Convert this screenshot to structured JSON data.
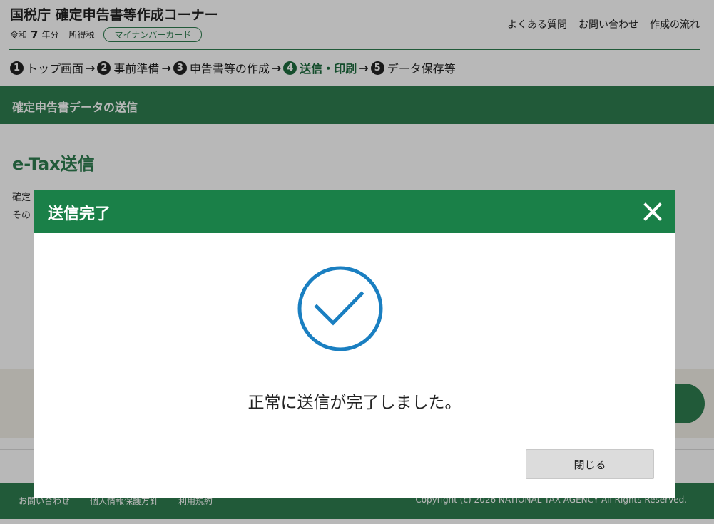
{
  "header": {
    "site_title": "国税庁 確定申告書等作成コーナー",
    "era": "令和",
    "year": "7",
    "year_suffix": "年分",
    "tax_type": "所得税",
    "badge": "マイナンバーカード",
    "links": [
      "よくある質問",
      "お問い合わせ",
      "作成の流れ"
    ]
  },
  "steps": [
    {
      "num": "1",
      "label": "トップ画面"
    },
    {
      "num": "2",
      "label": "事前準備"
    },
    {
      "num": "3",
      "label": "申告書等の作成"
    },
    {
      "num": "4",
      "label": "送信・印刷"
    },
    {
      "num": "5",
      "label": "データ保存等"
    }
  ],
  "steps_arrow": "→",
  "section": {
    "title": "確定申告書データの送信"
  },
  "main": {
    "heading": "e-Tax送信",
    "desc_line1": "確定",
    "desc_line2": "その"
  },
  "modal": {
    "title": "送信完了",
    "close_icon": "close-icon",
    "status_icon": "check-circle-icon",
    "message": "正常に送信が完了しました。",
    "close_button": "閉じる",
    "accent_color": "#1a8048",
    "check_color": "#1a7fc1"
  },
  "footer": {
    "links": [
      "お問い合わせ",
      "個人情報保護方針",
      "利用規約"
    ],
    "copyright": "Copyright (c)  2026 NATIONAL TAX AGENCY All Rights Reserved."
  }
}
